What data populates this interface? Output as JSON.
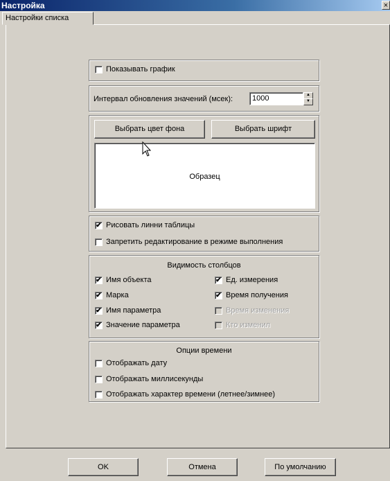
{
  "window": {
    "title": "Настройка",
    "close_glyph": "×"
  },
  "tabs": [
    {
      "label": "Настройки списка"
    }
  ],
  "show_chart": {
    "label": "Показывать график",
    "checked": false
  },
  "interval": {
    "label": "Интервал обновления значений (мсек):",
    "value": "1000"
  },
  "appearance": {
    "bg_color_button": "Выбрать цвет фона",
    "font_button": "Выбрать шрифт",
    "sample_text": "Образец"
  },
  "grid_options": {
    "draw_lines": {
      "label": "Рисовать линни таблицы",
      "checked": true
    },
    "forbid_edit": {
      "label": "Запретить редактирование  в режиме выполнения",
      "checked": false
    }
  },
  "columns": {
    "title": "Видимость столбцов",
    "left": [
      {
        "label": "Имя объекта",
        "checked": true
      },
      {
        "label": "Марка",
        "checked": true
      },
      {
        "label": "Имя параметра",
        "checked": true
      },
      {
        "label": "Значение параметра",
        "checked": true
      }
    ],
    "right": [
      {
        "label": "Ед. измерения",
        "checked": true,
        "enabled": true
      },
      {
        "label": "Время получения",
        "checked": true,
        "enabled": true
      },
      {
        "label": "Время изменения",
        "checked": false,
        "enabled": false
      },
      {
        "label": "Кто изменил",
        "checked": false,
        "enabled": false
      }
    ]
  },
  "time_options": {
    "title": "Опции времени",
    "items": [
      {
        "label": "Отображать дату",
        "checked": false
      },
      {
        "label": "Отображать миллисекунды",
        "checked": false
      },
      {
        "label": "Отображать характер времени (летнее/зимнее)",
        "checked": false
      }
    ]
  },
  "footer": {
    "ok": "OK",
    "cancel": "Отмена",
    "defaults": "По умолчанию"
  },
  "check_glyph": "✔",
  "colors": {
    "titlebar": "#0a246a",
    "face": "#d4d0c8"
  },
  "icons": {
    "spin_up": "▲",
    "spin_down": "▼"
  }
}
